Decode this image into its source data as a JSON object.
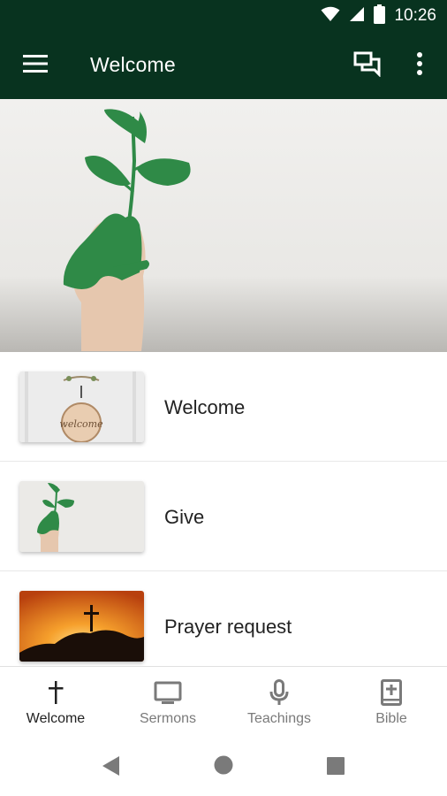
{
  "status_bar": {
    "time": "10:26"
  },
  "toolbar": {
    "title": "Welcome",
    "menu_icon": "hamburger-menu-icon",
    "chat_icon": "chat-bubbles-icon",
    "more_icon": "more-vertical-icon"
  },
  "hero": {
    "image": "hand-holding-green-plant"
  },
  "list": {
    "items": [
      {
        "label": "Welcome",
        "thumbnail": "welcome-door-sign"
      },
      {
        "label": "Give",
        "thumbnail": "hand-holding-green-plant"
      },
      {
        "label": "Prayer request",
        "thumbnail": "cross-on-hill-sunset"
      }
    ]
  },
  "bottom_nav": {
    "items": [
      {
        "label": "Welcome",
        "icon": "cross-icon",
        "active": true
      },
      {
        "label": "Sermons",
        "icon": "tv-icon",
        "active": false
      },
      {
        "label": "Teachings",
        "icon": "microphone-icon",
        "active": false
      },
      {
        "label": "Bible",
        "icon": "bible-icon",
        "active": false
      }
    ]
  },
  "colors": {
    "toolbar_bg": "#08331f",
    "plant_green": "#2f8a47",
    "nav_active": "#222222",
    "nav_inactive": "#7a7a7a"
  }
}
